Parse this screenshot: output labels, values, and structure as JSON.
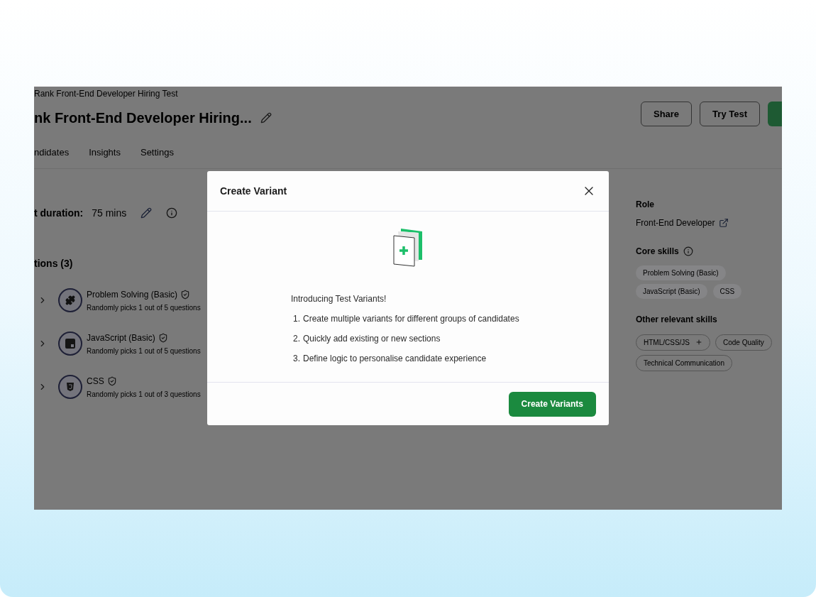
{
  "page": {
    "breadcrumb": "Rank Front-End Developer Hiring Test",
    "title": "nk Front-End Developer Hiring...",
    "header_buttons": [
      "Share",
      "Try Test"
    ],
    "tabs": [
      {
        "label": "ndidates"
      },
      {
        "label": "Insights"
      },
      {
        "label": "Settings"
      }
    ],
    "duration": {
      "label": "t duration:",
      "value": "75 mins"
    },
    "sections_heading": "tions (3)",
    "sections": [
      {
        "name": "Problem Solving (Basic)",
        "kind": "puzzle",
        "detail": "Randomly picks 1 out of 5 questions"
      },
      {
        "name": "JavaScript (Basic)",
        "kind": "js",
        "detail": "Randomly picks 1 out of 5 questions"
      },
      {
        "name": "CSS",
        "kind": "css",
        "detail": "Randomly picks 1 out of 3 questions"
      }
    ],
    "sidebar": {
      "role_label": "Role",
      "role": "Front-End Developer",
      "core_skills_label": "Core skills",
      "core_skills": [
        "Problem Solving (Basic)",
        "JavaScript (Basic)",
        "CSS"
      ],
      "other_skills_label": "Other relevant skills",
      "other_skills": [
        {
          "label": "HTML/CSS/JS",
          "kind": "add"
        },
        {
          "label": "Code Quality",
          "kind": "plain"
        },
        {
          "label": "Technical Communication",
          "kind": "plain"
        }
      ]
    }
  },
  "modal": {
    "title": "Create Variant",
    "intro": "Introducing Test Variants!",
    "steps": [
      {
        "number": "1.",
        "text": "Create multiple variants for different groups of candidates"
      },
      {
        "number": "2.",
        "text": "Quickly add existing or new sections"
      },
      {
        "number": "3.",
        "text": "Define logic to personalise candidate experience"
      }
    ],
    "button": "Create Variants"
  }
}
